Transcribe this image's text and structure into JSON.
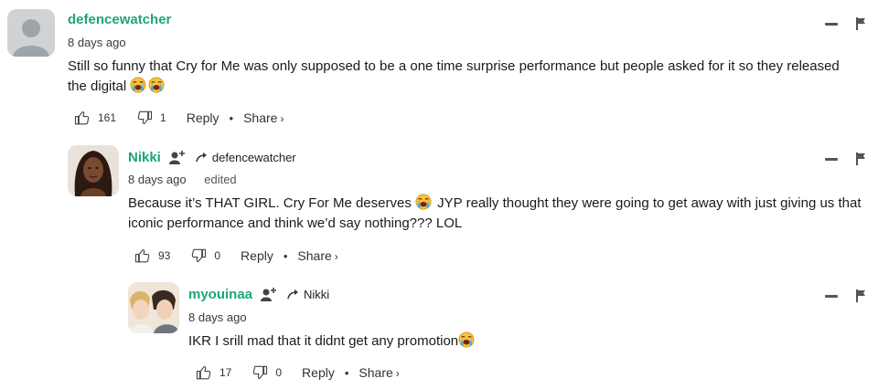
{
  "comments": [
    {
      "username": "defencewatcher",
      "timestamp": "8 days ago",
      "text": "Still so funny that Cry for Me was only supposed to be a one time surprise performance but people asked for it so they released the digital",
      "emojis": [
        "loudly-crying-face",
        "loudly-crying-face"
      ],
      "likes": "161",
      "dislikes": "1",
      "reply_label": "Reply",
      "share_label": "Share",
      "separator": "•",
      "share_chevron": "›"
    },
    {
      "username": "Nikki",
      "reply_to": "defencewatcher",
      "timestamp": "8 days ago",
      "edited_label": "edited",
      "text_before_emoji": "Because it’s THAT GIRL. Cry For Me deserves",
      "text_after_emoji": " JYP really thought they were going to get away with just giving us that iconic performance and think we’d say nothing??? LOL",
      "emoji": "loudly-crying-face",
      "likes": "93",
      "dislikes": "0",
      "reply_label": "Reply",
      "share_label": "Share",
      "separator": "•",
      "share_chevron": "›"
    },
    {
      "username": "myouinaa",
      "reply_to": "Nikki",
      "timestamp": "8 days ago",
      "text": "IKR I srill mad that it didnt get any promotion",
      "emoji": "loudly-crying-face",
      "likes": "17",
      "dislikes": "0",
      "reply_label": "Reply",
      "share_label": "Share",
      "separator": "•",
      "share_chevron": "›"
    }
  ],
  "colors": {
    "username": "#1ea672",
    "text": "#1a1a1a",
    "muted": "#3a3a3a"
  }
}
